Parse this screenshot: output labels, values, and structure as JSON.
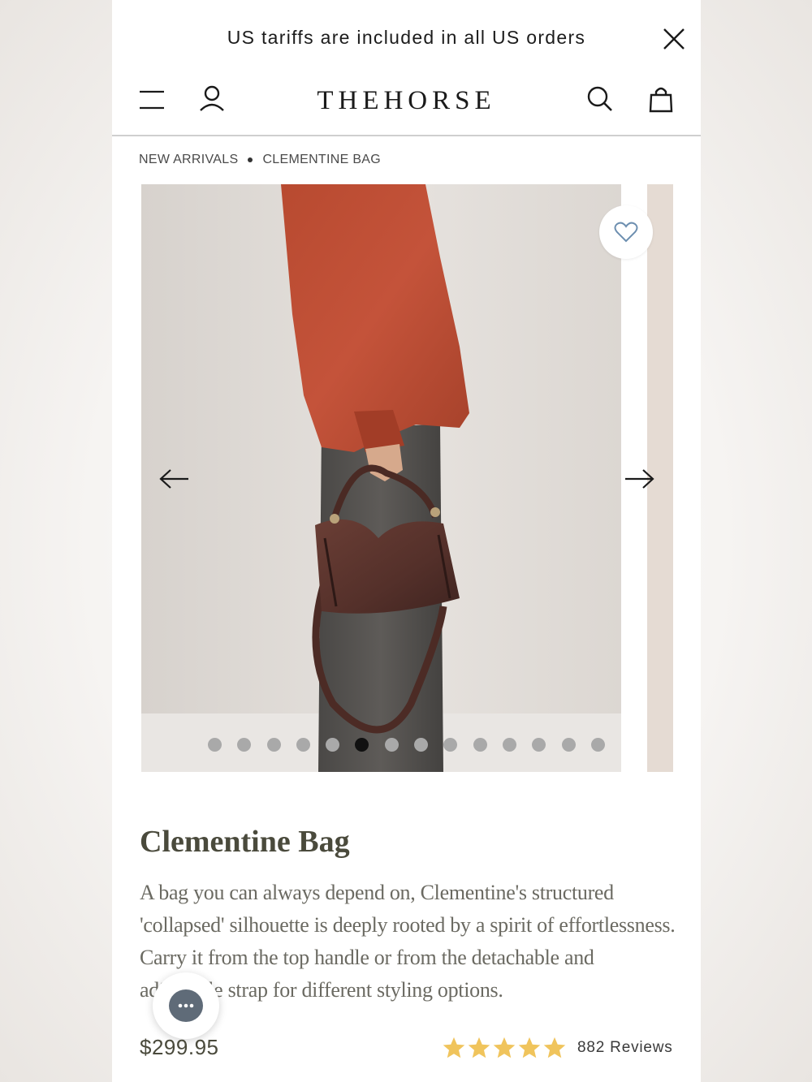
{
  "announcement": {
    "text": "US tariffs are included in all US orders"
  },
  "header": {
    "brand": "THEHORSE"
  },
  "breadcrumb": {
    "items": [
      "NEW ARRIVALS",
      "CLEMENTINE BAG"
    ]
  },
  "gallery": {
    "slide_count": 14,
    "active_slide": 6
  },
  "product": {
    "title": "Clementine Bag",
    "description": "A bag you can always depend on, Clementine's structured 'collapsed' silhouette is deeply rooted by a spirit of effortlessness. Carry it from the top handle or from the detachable and adjustable strap for different styling options.",
    "price": "$299.95",
    "rating": 5,
    "reviews_label": "882 Reviews"
  },
  "icons": {
    "close": "close-icon",
    "menu": "hamburger-icon",
    "account": "user-icon",
    "search": "search-icon",
    "bag": "shopping-bag-icon",
    "wishlist": "heart-icon",
    "prev": "arrow-left-icon",
    "next": "arrow-right-icon",
    "chat": "chat-icon",
    "star": "star-icon"
  },
  "colors": {
    "star": "#f0c45c",
    "heart": "#6d8fb0",
    "chat": "#5f6b78",
    "dot_active": "#111111",
    "dot_inactive": "#a9a9a9"
  }
}
